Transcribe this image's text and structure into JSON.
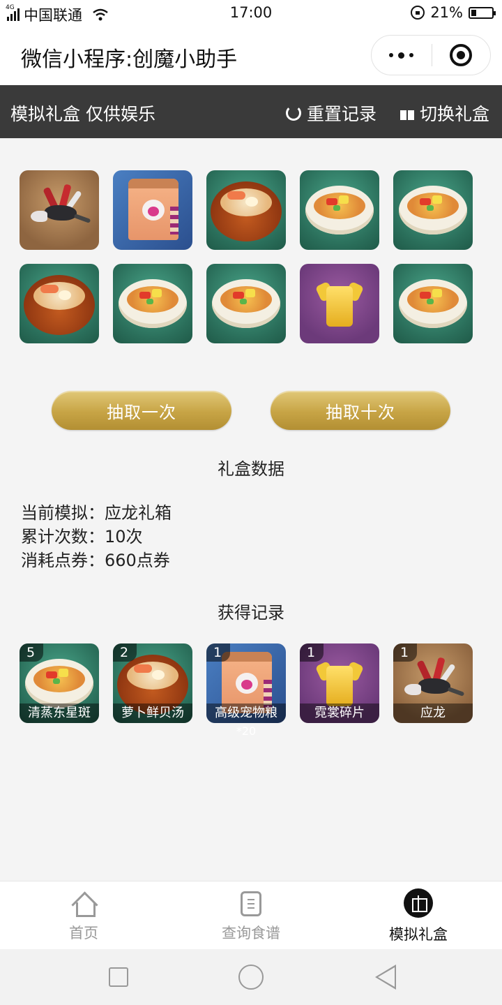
{
  "status_bar": {
    "network": "4G",
    "carrier": "中国联通",
    "time": "17:00",
    "battery": "21%"
  },
  "title_bar": {
    "title": "微信小程序:创魔小助手"
  },
  "header": {
    "left_text": "模拟礼盒 仅供娱乐",
    "reset_label": "重置记录",
    "switch_label": "切换礼盒"
  },
  "draw_results": [
    "dragon",
    "pet-food-bag",
    "wood-bowl-soup",
    "fish-bowl",
    "fish-bowl",
    "wood-bowl-soup",
    "fish-bowl",
    "fish-bowl",
    "shirt-fragment",
    "fish-bowl"
  ],
  "buttons": {
    "draw_one": "抽取一次",
    "draw_ten": "抽取十次"
  },
  "box_data": {
    "title": "礼盒数据",
    "current_label": "当前模拟：",
    "current_value": "应龙礼箱",
    "count_label": "累计次数：",
    "count_value": "10次",
    "cost_label": "消耗点券：",
    "cost_value": "660点券"
  },
  "record": {
    "title": "获得记录",
    "items": [
      {
        "count": "5",
        "name": "清蒸东星斑",
        "type": "fish-bowl"
      },
      {
        "count": "2",
        "name": "萝卜鲜贝汤",
        "type": "wood-bowl-soup"
      },
      {
        "count": "1",
        "name": "高级宠物粮",
        "type": "pet-food-bag",
        "sub": "*20"
      },
      {
        "count": "1",
        "name": "霓裳碎片",
        "type": "shirt-fragment"
      },
      {
        "count": "1",
        "name": "应龙",
        "type": "dragon"
      }
    ]
  },
  "tabbar": {
    "items": [
      {
        "label": "首页",
        "icon": "home-icon"
      },
      {
        "label": "查询食谱",
        "icon": "recipe-icon"
      },
      {
        "label": "模拟礼盒",
        "icon": "gift-icon",
        "active": true
      }
    ]
  }
}
